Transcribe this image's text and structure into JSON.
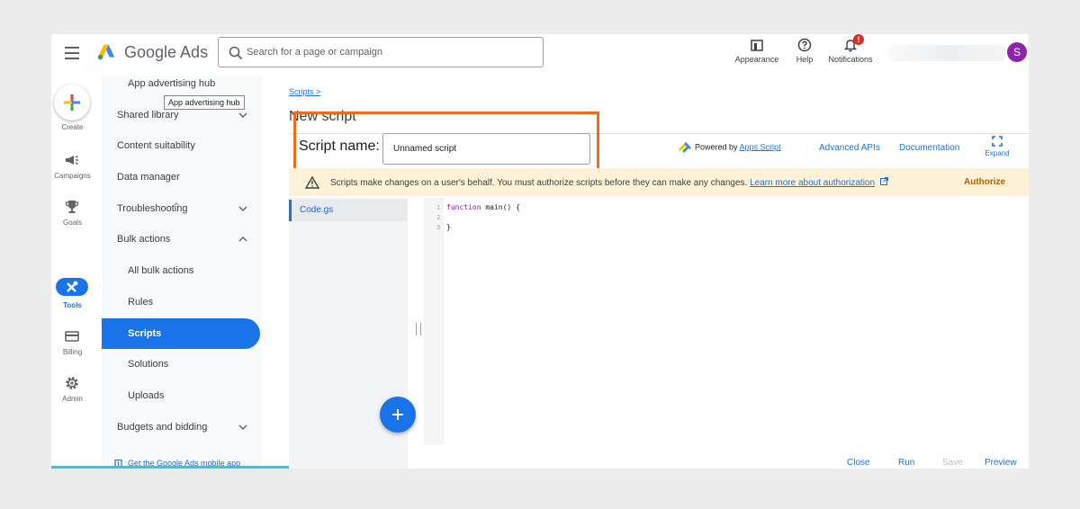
{
  "header": {
    "brand": "Google Ads",
    "search_placeholder": "Search for a page or campaign",
    "appearance_label": "Appearance",
    "help_label": "Help",
    "notifications_label": "Notifications",
    "notifications_badge": "!",
    "avatar_initial": "S"
  },
  "rail": {
    "create": "Create",
    "campaigns": "Campaigns",
    "goals": "Goals",
    "tools": "Tools",
    "billing": "Billing",
    "admin": "Admin"
  },
  "sidenav": {
    "items": [
      {
        "label": "App advertising hub"
      },
      {
        "label": "Shared library"
      },
      {
        "label": "Content suitability"
      },
      {
        "label": "Data manager"
      },
      {
        "label": "Troubleshooting"
      },
      {
        "label": "Bulk actions"
      },
      {
        "label": "All bulk actions"
      },
      {
        "label": "Rules"
      },
      {
        "label": "Scripts"
      },
      {
        "label": "Solutions"
      },
      {
        "label": "Uploads"
      },
      {
        "label": "Budgets and bidding"
      }
    ],
    "tooltip": "App advertising hub",
    "mobile_link": "Get the Google Ads mobile app"
  },
  "main": {
    "breadcrumb": "Scripts >",
    "page_title": "New script",
    "script_name_label": "Script name:",
    "script_name_value": "Unnamed script",
    "powered_by": "Powered by",
    "apps_script": "Apps Script",
    "advanced_apis": "Advanced APIs",
    "documentation": "Documentation",
    "expand": "Expand",
    "warning_text": "Scripts make changes on a user's behalf. You must authorize scripts before they can make any changes.",
    "warning_link": "Learn more about authorization",
    "authorize": "Authorize",
    "file_name": "Code.gs",
    "code_lines": [
      {
        "num": "1",
        "kw": "function",
        "rest": " main() {"
      },
      {
        "num": "2",
        "kw": "",
        "rest": ""
      },
      {
        "num": "3",
        "kw": "",
        "rest": "}"
      }
    ]
  },
  "footer": {
    "close": "Close",
    "run": "Run",
    "save": "Save",
    "preview": "Preview"
  },
  "colors": {
    "accent": "#1a73e8",
    "highlight": "#ee6c1b",
    "warning_bg": "#fdf2d7"
  }
}
